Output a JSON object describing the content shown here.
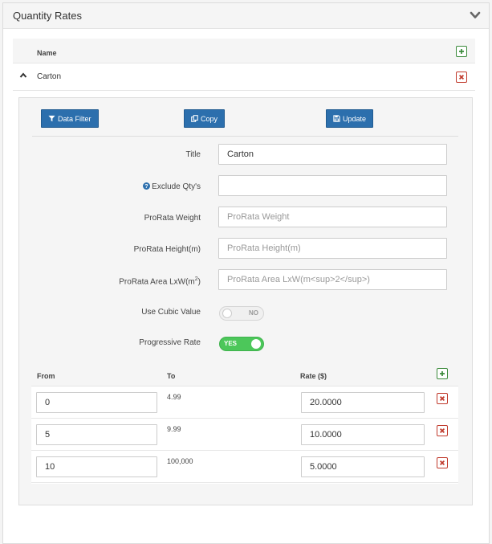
{
  "panel": {
    "title": "Quantity Rates"
  },
  "grid": {
    "name_header": "Name",
    "rows": [
      {
        "name": "Carton"
      }
    ]
  },
  "toolbar": {
    "data_filter": "Data Filter",
    "copy": "Copy",
    "update": "Update"
  },
  "form": {
    "title_label": "Title",
    "title_value": "Carton",
    "exclude_label": "Exclude Qty's",
    "exclude_value": "",
    "prorata_weight_label": "ProRata Weight",
    "prorata_weight_placeholder": "ProRata Weight",
    "prorata_height_label": "ProRata Height(m)",
    "prorata_height_placeholder": "ProRata Height(m)",
    "prorata_area_label_prefix": "ProRata Area LxW(m",
    "prorata_area_label_sup": "2",
    "prorata_area_label_suffix": ")",
    "prorata_area_placeholder": "ProRata Area LxW(m<sup>2</sup>)",
    "use_cubic_label": "Use Cubic Value",
    "use_cubic_state": "NO",
    "progressive_label": "Progressive Rate",
    "progressive_state": "YES"
  },
  "rates": {
    "headers": {
      "from": "From",
      "to": "To",
      "rate": "Rate ($)"
    },
    "rows": [
      {
        "from": "0",
        "to": "4.99",
        "rate": "20.0000"
      },
      {
        "from": "5",
        "to": "9.99",
        "rate": "10.0000"
      },
      {
        "from": "10",
        "to": "100,000",
        "rate": "5.0000"
      }
    ]
  },
  "colors": {
    "primary_button": "#2c6fad",
    "toggle_on": "#4cc75a",
    "add_icon": "#3b8a3b",
    "delete_icon": "#c0392b"
  }
}
